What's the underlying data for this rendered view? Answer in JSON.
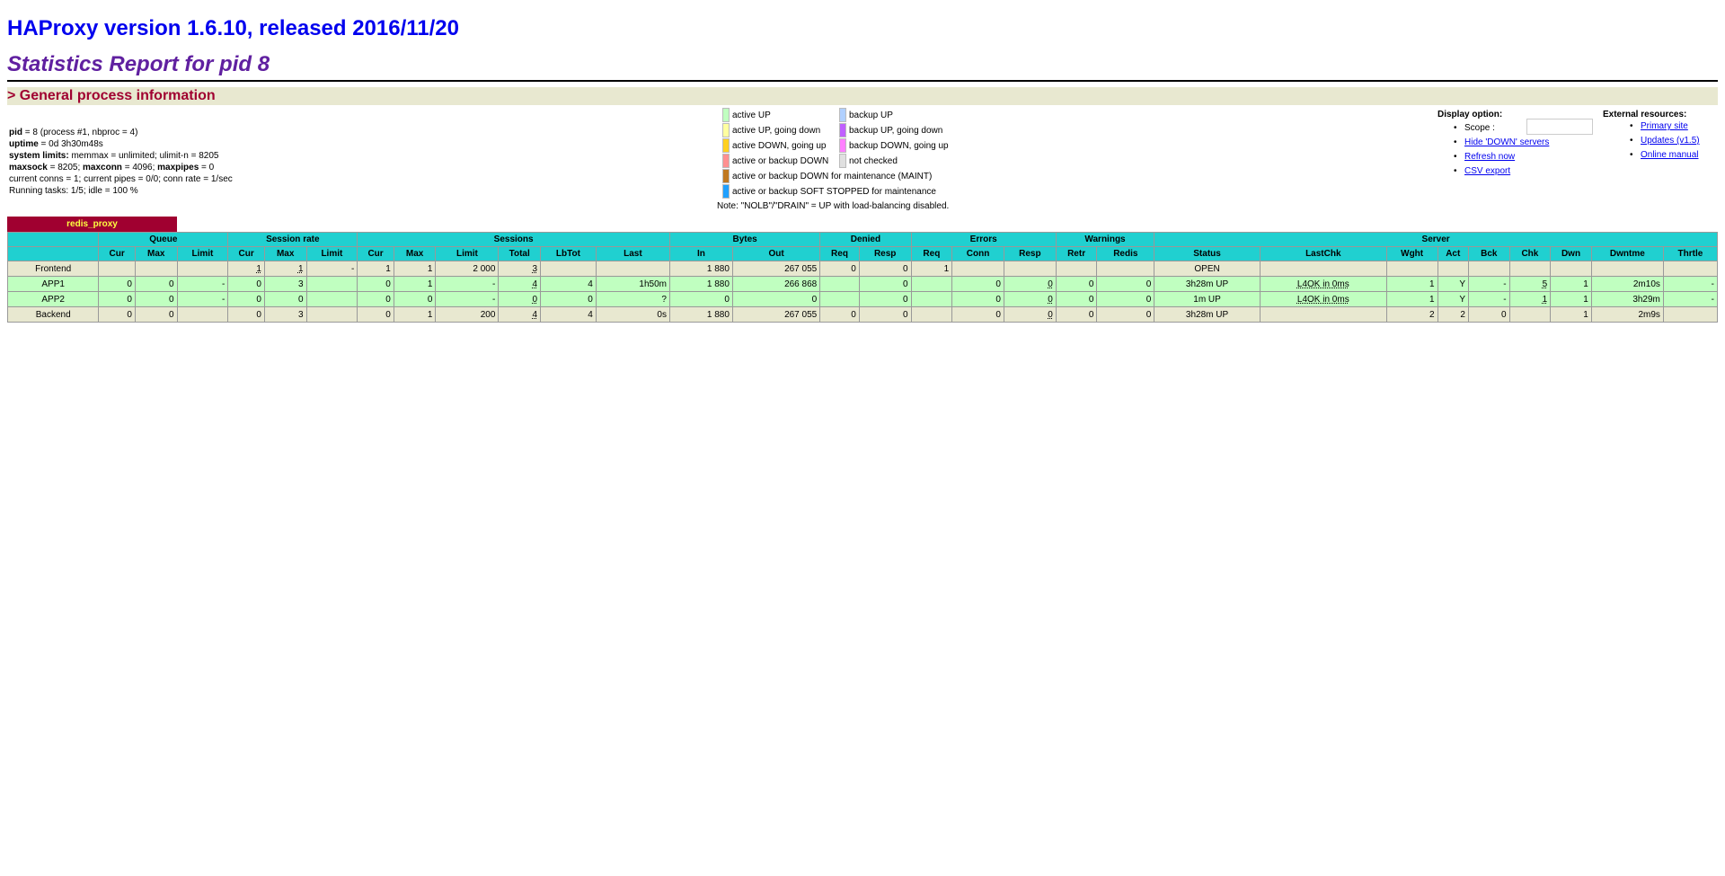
{
  "header": {
    "title": "HAProxy version 1.6.10, released 2016/11/20",
    "subtitle": "Statistics Report for pid 8"
  },
  "section": {
    "general": "> General process information"
  },
  "info": {
    "pid_label": "pid",
    "pid_value": " = 8 (process #1, nbproc = 4)",
    "uptime_label": "uptime",
    "uptime_value": " = 0d 3h30m48s",
    "syslimits_label": "system limits:",
    "syslimits_value": " memmax = unlimited; ulimit-n = 8205",
    "maxsock_label": "maxsock",
    "maxsock_value": " = 8205; ",
    "maxconn_label": "maxconn",
    "maxconn_value": " = 4096; ",
    "maxpipes_label": "maxpipes",
    "maxpipes_value": " = 0",
    "conns_line": "current conns = 1; current pipes = 0/0; conn rate = 1/sec",
    "tasks_line": "Running tasks: 1/5; idle = 100 %"
  },
  "legend": {
    "items_left": [
      {
        "label": "active UP",
        "color": "#c0ffc0"
      },
      {
        "label": "active UP, going down",
        "color": "#ffffa0"
      },
      {
        "label": "active DOWN, going up",
        "color": "#ffd020"
      },
      {
        "label": "active or backup DOWN",
        "color": "#ff9090"
      },
      {
        "label": "active or backup DOWN for maintenance (MAINT)",
        "color": "#c07820"
      },
      {
        "label": "active or backup SOFT STOPPED for maintenance",
        "color": "#20a0ff"
      }
    ],
    "items_right": [
      {
        "label": "backup UP",
        "color": "#b0d0ff"
      },
      {
        "label": "backup UP, going down",
        "color": "#c060ff"
      },
      {
        "label": "backup DOWN, going up",
        "color": "#ff80ff"
      },
      {
        "label": "not checked",
        "color": "#e0e0e0"
      }
    ],
    "note": "Note: \"NOLB\"/\"DRAIN\" = UP with load-balancing disabled."
  },
  "display_option": {
    "heading": "Display option:",
    "scope_label": "Scope :",
    "scope_value": "",
    "links": [
      "Hide 'DOWN' servers",
      "Refresh now",
      "CSV export"
    ]
  },
  "external_resources": {
    "heading": "External resources:",
    "links": [
      "Primary site",
      "Updates (v1.5)",
      "Online manual"
    ]
  },
  "proxy": {
    "name": "redis_proxy",
    "groups": [
      {
        "label": "",
        "span": 1
      },
      {
        "label": "Queue",
        "span": 3
      },
      {
        "label": "Session rate",
        "span": 3
      },
      {
        "label": "Sessions",
        "span": 6
      },
      {
        "label": "Bytes",
        "span": 2
      },
      {
        "label": "Denied",
        "span": 2
      },
      {
        "label": "Errors",
        "span": 3
      },
      {
        "label": "Warnings",
        "span": 2
      },
      {
        "label": "Server",
        "span": 9
      }
    ],
    "columns": [
      "",
      "Cur",
      "Max",
      "Limit",
      "Cur",
      "Max",
      "Limit",
      "Cur",
      "Max",
      "Limit",
      "Total",
      "LbTot",
      "Last",
      "In",
      "Out",
      "Req",
      "Resp",
      "Req",
      "Conn",
      "Resp",
      "Retr",
      "Redis",
      "Status",
      "LastChk",
      "Wght",
      "Act",
      "Bck",
      "Chk",
      "Dwn",
      "Dwntme",
      "Thrtle"
    ],
    "rows": [
      {
        "kind": "fe",
        "cells": [
          "Frontend",
          "",
          "",
          "",
          "1",
          "1",
          "-",
          "1",
          "1",
          "2 000",
          "3",
          "",
          "",
          "1 880",
          "267 055",
          "0",
          "0",
          "1",
          "",
          "",
          "",
          "",
          "OPEN",
          "",
          "",
          "",
          "",
          "",
          "",
          "",
          ""
        ]
      },
      {
        "kind": "srv",
        "cells": [
          "APP1",
          "0",
          "0",
          "-",
          "0",
          "3",
          "",
          "0",
          "1",
          "-",
          "4",
          "4",
          "1h50m",
          "1 880",
          "266 868",
          "",
          "0",
          "",
          "0",
          "0",
          "0",
          "0",
          "3h28m UP",
          "L4OK in 0ms",
          "1",
          "Y",
          "-",
          "5",
          "1",
          "2m10s",
          "-"
        ]
      },
      {
        "kind": "srv",
        "cells": [
          "APP2",
          "0",
          "0",
          "-",
          "0",
          "0",
          "",
          "0",
          "0",
          "-",
          "0",
          "0",
          "?",
          "0",
          "0",
          "",
          "0",
          "",
          "0",
          "0",
          "0",
          "0",
          "1m UP",
          "L4OK in 0ms",
          "1",
          "Y",
          "-",
          "1",
          "1",
          "3h29m",
          "-"
        ]
      },
      {
        "kind": "be",
        "cells": [
          "Backend",
          "0",
          "0",
          "",
          "0",
          "3",
          "",
          "0",
          "1",
          "200",
          "4",
          "4",
          "0s",
          "1 880",
          "267 055",
          "0",
          "0",
          "",
          "0",
          "0",
          "0",
          "0",
          "3h28m UP",
          "",
          "2",
          "2",
          "0",
          "",
          "1",
          "2m9s",
          ""
        ]
      }
    ]
  }
}
